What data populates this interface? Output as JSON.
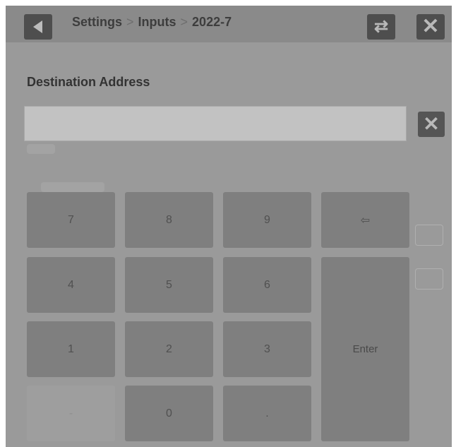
{
  "header": {
    "breadcrumb": [
      "Settings",
      "Inputs",
      "2022-7"
    ],
    "separator": ">"
  },
  "dialog": {
    "label": "Destination Address",
    "input_value": "",
    "clear_label": "X"
  },
  "keypad": {
    "rows": [
      [
        "7",
        "8",
        "9",
        "⇦"
      ],
      [
        "4",
        "5",
        "6",
        "Enter"
      ],
      [
        "1",
        "2",
        "3"
      ],
      [
        "-",
        "0",
        "."
      ]
    ]
  },
  "icons": {
    "back": "back-arrow-icon",
    "swap": "swap-arrows-icon",
    "close": "close-icon",
    "clear": "clear-x-icon"
  }
}
